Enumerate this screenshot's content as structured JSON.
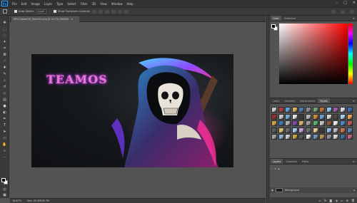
{
  "app": {
    "logo_text": "Ps"
  },
  "menu": {
    "items": [
      "File",
      "Edit",
      "Image",
      "Layer",
      "Type",
      "Select",
      "Filter",
      "3D",
      "View",
      "Window",
      "Help"
    ]
  },
  "options_bar": {
    "auto_select_label": "Auto-Select:",
    "auto_select_value": "Layer",
    "show_transform_label": "Show Transform Controls"
  },
  "document": {
    "tab_title": "MP4 DiabelOS_TeamOS.png @ 16.7% (RGB/8)",
    "artwork_text": "TEAMOS"
  },
  "status_bar": {
    "zoom": "16.67%",
    "doc_info": "Doc: 45.2M/28.7M"
  },
  "color_panel": {
    "tabs": [
      "Color",
      "Swatches"
    ]
  },
  "styles_panel": {
    "tabs": [
      "Learn",
      "Libraries",
      "Adjustments",
      "Styles"
    ],
    "swatch_colors": [
      "#c8c8c8",
      "#b33a3a",
      "#5a9fd4",
      "#d4b35a",
      "#4e7bb0",
      "#8a8a8a",
      "#6fa86f",
      "#c26b3a",
      "#8cc0e8",
      "#a05ab0",
      "#d9d9d9",
      "#3a6ab3",
      "#9b2f2f",
      "#c9c9c9",
      "#7aa7d6",
      "#e0e0e0",
      "#3d3d3d",
      "#b5b5b5",
      "#c98b3a",
      "#6a9ad0",
      "#d6d6d6",
      "#4a4a4a",
      "#a8d0f0",
      "#e8a05a",
      "#cfa34a",
      "#3a7ab3",
      "#b0b0b0",
      "#7d4ab0",
      "#d0b060",
      "#9e9e9e",
      "#5ab070",
      "#c0c0c0",
      "#8a5a3a",
      "#e8e8e8",
      "#4a8ac0",
      "#b85a5a",
      "#5a5a5a",
      "#d8c070",
      "#6a6a6a",
      "#a0c8e8",
      "#c8a0d8",
      "#707070",
      "#e0c890",
      "#3a3a3a",
      "#90b8e0",
      "#b8b8b8",
      "#d07050",
      "#6080b0",
      "#a0a0a0",
      "#8ab4d8",
      "#cccccc",
      "#c8a040",
      "#585858",
      "#e6e6e6",
      "#7090c0",
      "#b0905a",
      "#909090",
      "#d4d4d4",
      "#4070a0",
      "#c06080"
    ]
  },
  "layers_panel": {
    "tabs": [
      "Layers",
      "Channels",
      "Paths"
    ],
    "layers": [
      {
        "name": "Background"
      }
    ]
  }
}
